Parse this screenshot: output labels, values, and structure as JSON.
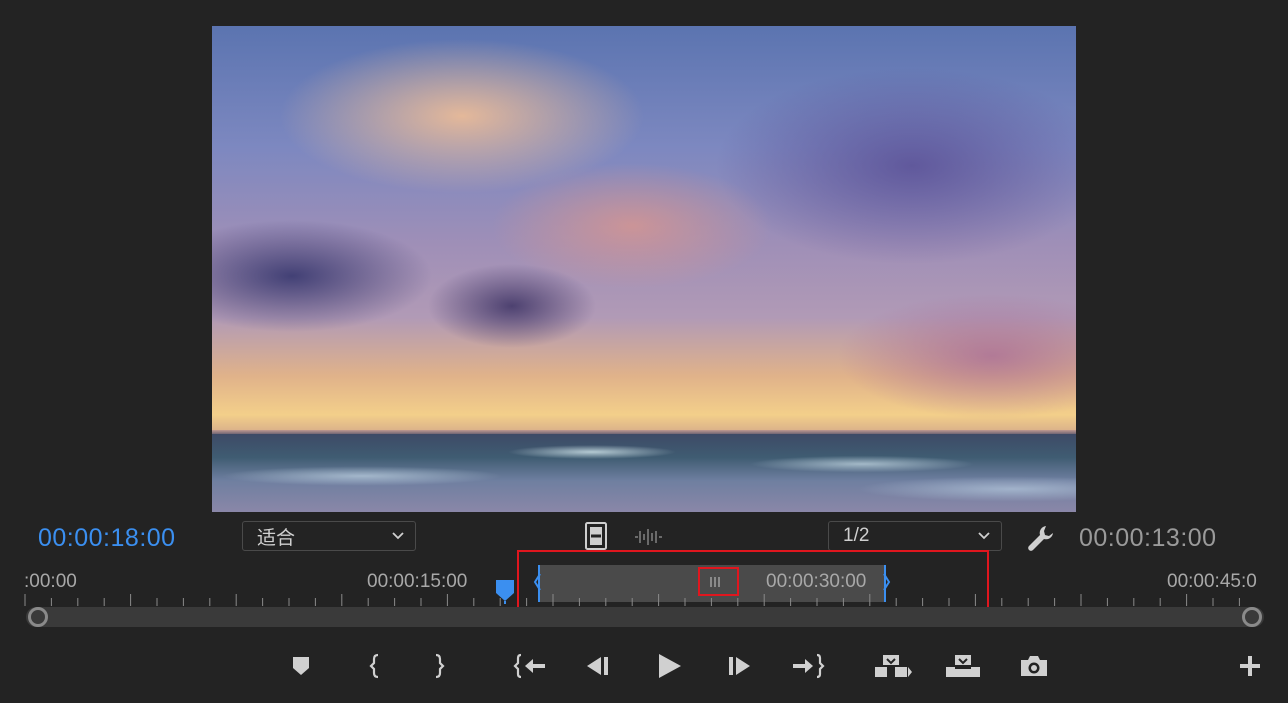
{
  "monitor": {
    "current_timecode": "00:00:18:00",
    "duration_timecode": "00:00:13:00",
    "zoom_level": "适合",
    "resolution": "1/2"
  },
  "ruler": {
    "labels": [
      ":00:00",
      "00:00:15:00",
      "00:00:30:00",
      "00:00:45:0"
    ]
  },
  "work_area": {
    "label": "00:00:30:00"
  },
  "icons": {
    "settings": "wrench-icon",
    "drop_video": "film-icon",
    "drop_audio": "audio-waveform-icon"
  },
  "transport": [
    "add-marker-button",
    "mark-in-button",
    "mark-out-button",
    "go-to-in-button",
    "step-back-button",
    "play-button",
    "step-forward-button",
    "go-to-out-button",
    "insert-button",
    "overwrite-button",
    "export-frame-button",
    "add-button"
  ],
  "colors": {
    "accent_blue": "#3b8ff0",
    "highlight_red": "#e0161e",
    "panel_bg": "#232323"
  }
}
